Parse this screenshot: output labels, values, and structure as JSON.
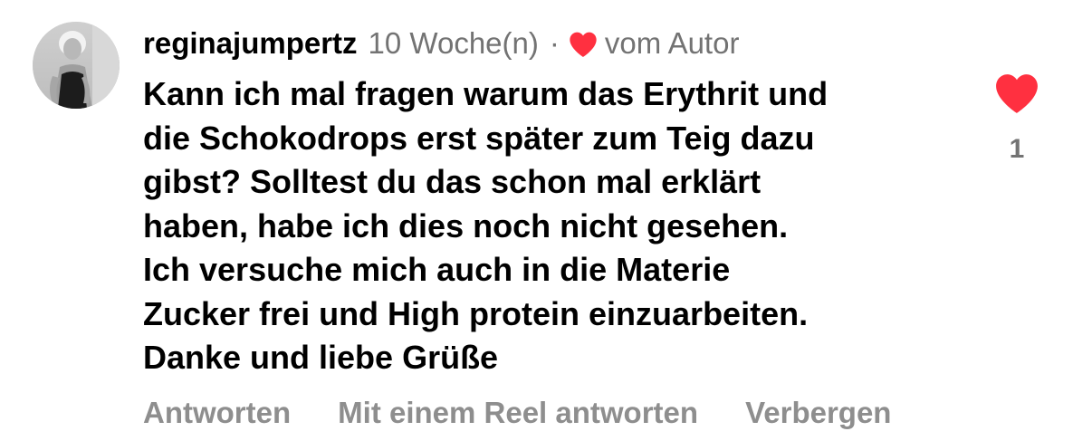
{
  "comment": {
    "username": "reginajumpertz",
    "time_ago": "10 Woche(n)",
    "separator": "·",
    "author_liked_label": "vom Autor",
    "body_lines": [
      "Kann ich mal fragen warum das Erythrit und",
      "die Schokodrops erst später zum Teig dazu",
      "gibst? Solltest du das schon mal erklärt",
      "haben, habe ich dies noch nicht gesehen.",
      "Ich versuche mich auch in die Materie",
      "Zucker frei und High protein einzuarbeiten.",
      "Danke und liebe Grüße"
    ],
    "like_count": "1",
    "liked": true,
    "like_color": "#ff3040",
    "actions": {
      "reply": "Antworten",
      "reply_with_reel": "Mit einem Reel antworten",
      "hide": "Verbergen"
    },
    "icons": {
      "author_like": "heart-icon",
      "like": "heart-icon"
    }
  }
}
